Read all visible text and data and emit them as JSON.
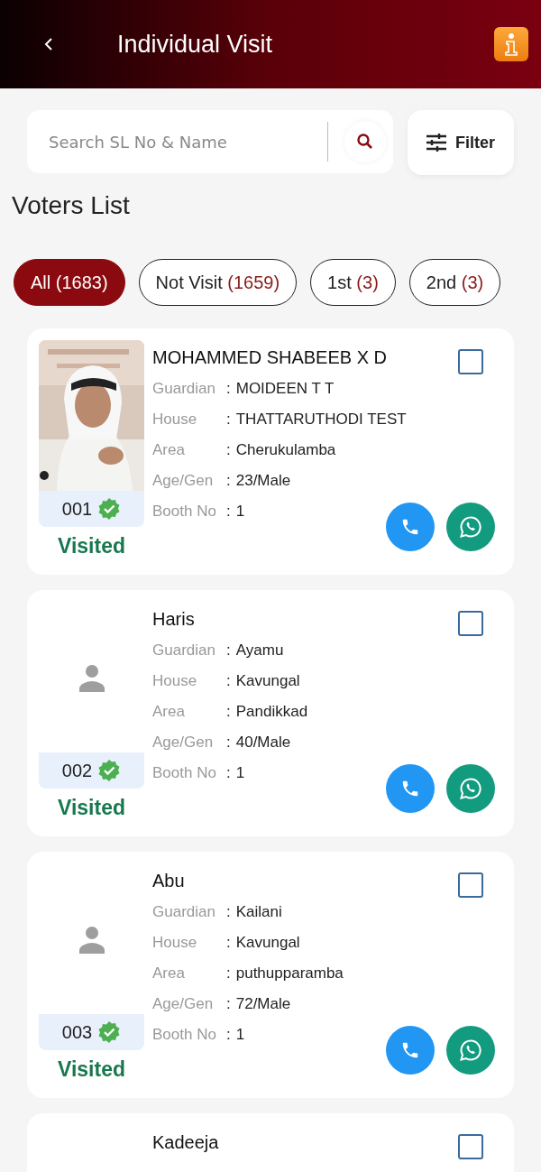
{
  "header": {
    "title": "Individual Visit"
  },
  "search": {
    "placeholder": "Search SL No & Name"
  },
  "filter_button": {
    "label": "Filter"
  },
  "section_title": "Voters List",
  "chips": [
    {
      "label": "All",
      "count": "(1683)",
      "selected": true
    },
    {
      "label": "Not Visit",
      "count": "(1659)",
      "selected": false
    },
    {
      "label": "1st",
      "count": "(3)",
      "selected": false
    },
    {
      "label": "2nd",
      "count": "(3)",
      "selected": false
    }
  ],
  "voters": [
    {
      "name": "MOHAMMED SHABEEB X D",
      "kind": "picture",
      "serial": "001",
      "verified": true,
      "status": "Visited",
      "checked": false,
      "fields": [
        {
          "label": "Guardian",
          "separator": ":",
          "value": "MOIDEEN T T"
        },
        {
          "label": "House",
          "separator": ":",
          "value": "THATTARUTHODI TEST"
        },
        {
          "label": "Area",
          "separator": ":",
          "value": "Cherukulamba"
        },
        {
          "label": "Age/Gen",
          "separator": ":",
          "value": "23/Male"
        },
        {
          "label": "Booth No",
          "separator": ":",
          "value": "1"
        }
      ]
    },
    {
      "name": "Haris",
      "kind": "avatar",
      "serial": "002",
      "verified": true,
      "status": "Visited",
      "checked": false,
      "fields": [
        {
          "label": "Guardian",
          "separator": ":",
          "value": "Ayamu"
        },
        {
          "label": "House",
          "separator": ":",
          "value": "Kavungal"
        },
        {
          "label": "Area",
          "separator": ":",
          "value": "Pandikkad"
        },
        {
          "label": "Age/Gen",
          "separator": ":",
          "value": "40/Male"
        },
        {
          "label": "Booth No",
          "separator": ":",
          "value": "1"
        }
      ]
    },
    {
      "name": "Abu",
      "kind": "avatar",
      "serial": "003",
      "verified": true,
      "status": "Visited",
      "checked": false,
      "fields": [
        {
          "label": "Guardian",
          "separator": ":",
          "value": "Kailani"
        },
        {
          "label": "House",
          "separator": ":",
          "value": "Kavungal"
        },
        {
          "label": "Area",
          "separator": ":",
          "value": "puthupparamba"
        },
        {
          "label": "Age/Gen",
          "separator": ":",
          "value": "72/Male"
        },
        {
          "label": "Booth No",
          "separator": ":",
          "value": "1"
        }
      ]
    },
    {
      "name": "Kadeeja",
      "checked": false
    }
  ]
}
